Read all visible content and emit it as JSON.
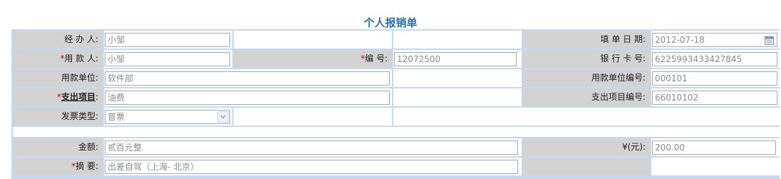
{
  "page_title": "个人报销单",
  "form": {
    "handler_label": "经 办 人:",
    "handler_value": "小邹",
    "fill_date_label": "填 单 日 期:",
    "fill_date_value": "2012-07-18",
    "payee_required": "*",
    "payee_label": "用 款 人:",
    "payee_value": "小邹",
    "number_required": "*",
    "number_label": "编    号:",
    "number_value": "12072500",
    "bank_card_label": "银 行 卡 号:",
    "bank_card_value": "6225993433427845",
    "unit_label": "用款单位:",
    "unit_value": "软件部",
    "unit_code_label": "用款单位编号:",
    "unit_code_value": "000101",
    "expense_item_required": "*",
    "expense_item_label": "支出项目",
    "expense_item_colon": ":",
    "expense_item_value": "油费",
    "expense_code_label": "支出项目编号:",
    "expense_code_value": "66010102",
    "invoice_type_label": "发票类型:",
    "invoice_type_value": "普票",
    "amount_label": "金额:",
    "amount_value": "贰百元整",
    "currency_label": "¥(元):",
    "currency_value": "200.00",
    "summary_required": "*",
    "summary_label": "摘    要:",
    "summary_value": "出差自驾（上海- 北京）"
  },
  "icons": {
    "calendar": "calendar-icon",
    "dropdown": "chevron-down-icon"
  },
  "colors": {
    "title": "#2a6fb8",
    "grid": "#c7d9ee",
    "label_bg": "#d3d3d3",
    "required": "#e00000"
  }
}
